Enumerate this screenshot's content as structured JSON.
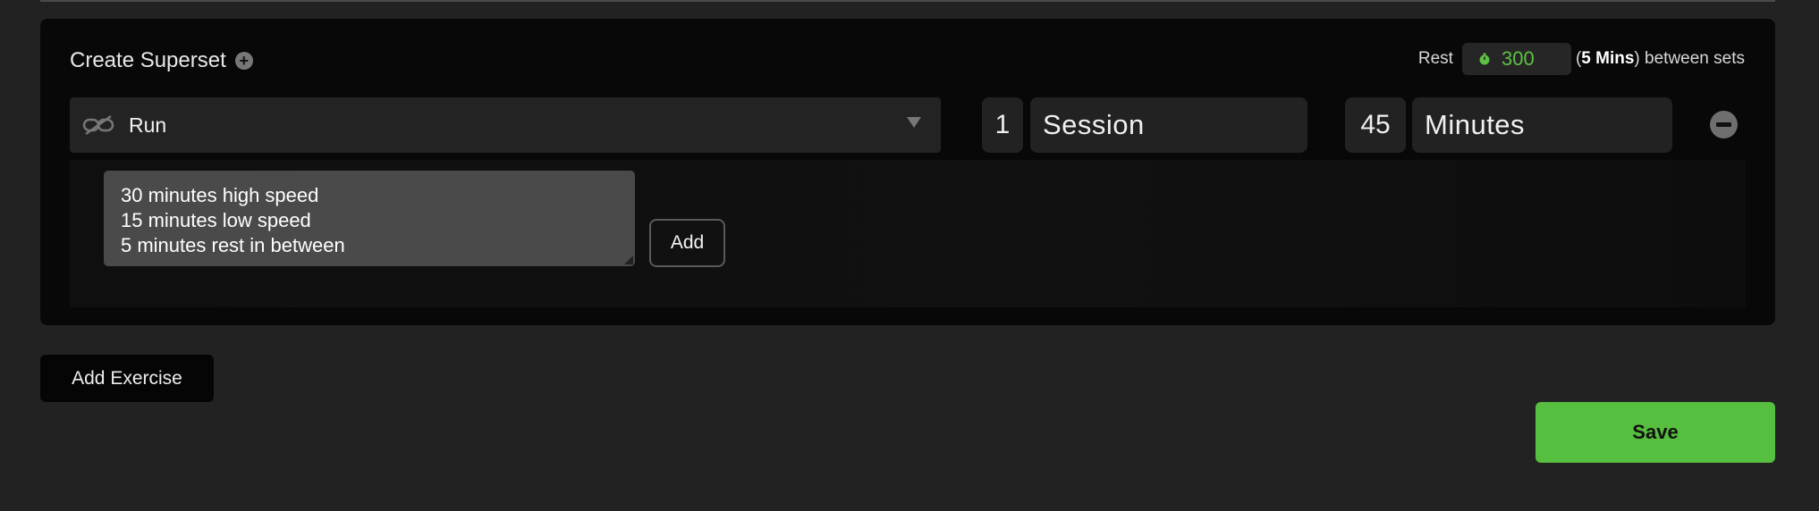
{
  "superset": {
    "title": "Create Superset",
    "rest_label": "Rest",
    "rest_value": "300",
    "rest_minutes": "5 Mins",
    "rest_suffix": "between sets"
  },
  "exercise": {
    "name": "Run",
    "sets_value": "1",
    "sets_unit": "Session",
    "duration_value": "45",
    "duration_unit": "Minutes"
  },
  "notes": {
    "text": "30 minutes high speed\n15 minutes low speed\n5 minutes rest in between",
    "add_label": "Add"
  },
  "actions": {
    "add_exercise_label": "Add Exercise",
    "save_label": "Save"
  },
  "colors": {
    "accent": "#57bf3f",
    "rest_value": "#5dc043"
  },
  "icons": {
    "title_add": "plus-circle-icon",
    "rest_timer": "timer-icon",
    "exercise_link": "unlink-icon",
    "dropdown": "chevron-down-icon",
    "remove": "minus-circle-icon"
  }
}
